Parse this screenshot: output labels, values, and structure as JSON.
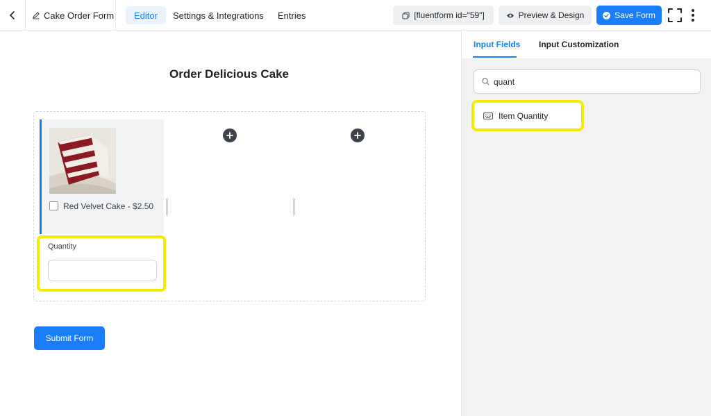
{
  "header": {
    "form_title": "Cake Order Form",
    "tabs": [
      {
        "label": "Editor",
        "active": true
      },
      {
        "label": "Settings & Integrations",
        "active": false
      },
      {
        "label": "Entries",
        "active": false
      }
    ],
    "shortcode": "[fluentform id=\"59\"]",
    "preview_label": "Preview & Design",
    "save_label": "Save Form"
  },
  "form": {
    "heading": "Order Delicious Cake",
    "checkbox_option": "Red Velvet Cake - $2.50",
    "quantity_label": "Quantity",
    "quantity_value": "",
    "submit_label": "Submit Form"
  },
  "sidebar": {
    "tabs": [
      {
        "label": "Input Fields",
        "active": true
      },
      {
        "label": "Input Customization",
        "active": false
      }
    ],
    "search_value": "quant",
    "results": [
      {
        "label": "Item Quantity",
        "icon": "keyboard-icon"
      }
    ]
  },
  "colors": {
    "accent": "#1a7efb",
    "highlight": "#f1ec00"
  }
}
